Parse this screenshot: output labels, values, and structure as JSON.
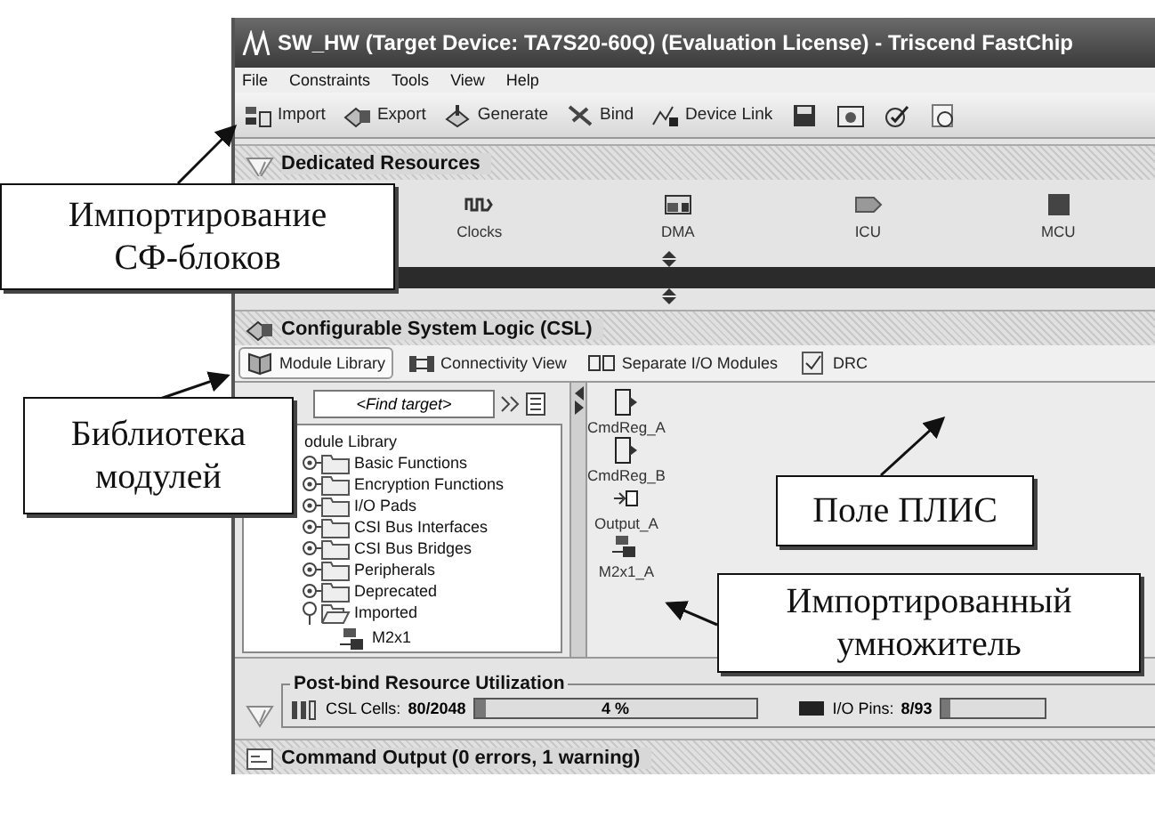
{
  "window": {
    "title": "SW_HW (Target Device: TA7S20-60Q) (Evaluation License) - Triscend FastChip"
  },
  "menu": [
    "File",
    "Constraints",
    "Tools",
    "View",
    "Help"
  ],
  "toolbar": [
    {
      "kind": "import",
      "label": "Import"
    },
    {
      "kind": "export",
      "label": "Export"
    },
    {
      "kind": "generate",
      "label": "Generate"
    },
    {
      "kind": "bind",
      "label": "Bind"
    },
    {
      "kind": "link",
      "label": "Device Link"
    },
    {
      "kind": "save"
    },
    {
      "kind": "window"
    },
    {
      "kind": "check"
    },
    {
      "kind": "timer"
    }
  ],
  "dedicated_resources": {
    "title": "Dedicated Resources",
    "items": [
      {
        "kind": "clock",
        "label": "Clocks"
      },
      {
        "kind": "dma",
        "label": "DMA"
      },
      {
        "kind": "intr",
        "label": "ICU"
      },
      {
        "kind": "mcu",
        "label": "MCU"
      }
    ]
  },
  "csl": {
    "title": "Configurable System Logic (CSL)",
    "tabs": [
      {
        "kind": "library",
        "label": "Module Library",
        "selected": true
      },
      {
        "kind": "connect",
        "label": "Connectivity View",
        "selected": false
      },
      {
        "kind": "separate",
        "label": "Separate I/O Modules",
        "selected": false
      },
      {
        "kind": "drc",
        "label": "DRC",
        "selected": false
      }
    ],
    "find": {
      "value": "<Find target>"
    },
    "tree": {
      "label": "odule Library",
      "children": [
        {
          "label": "Basic Functions",
          "expanded": false
        },
        {
          "label": "Encryption Functions",
          "expanded": false
        },
        {
          "label": "I/O Pads",
          "expanded": false
        },
        {
          "label": "CSI Bus Interfaces",
          "expanded": false
        },
        {
          "label": "CSI Bus Bridges",
          "expanded": false
        },
        {
          "label": "Peripherals",
          "expanded": false
        },
        {
          "label": "Deprecated",
          "expanded": false
        },
        {
          "label": "Imported",
          "expanded": true,
          "children": [
            {
              "label": "M2x1"
            }
          ]
        }
      ]
    },
    "modules": [
      {
        "kind": "register",
        "label": "CmdReg_A"
      },
      {
        "kind": "register",
        "label": "CmdReg_B"
      },
      {
        "kind": "output",
        "label": "Output_A"
      },
      {
        "kind": "multiplier",
        "label": "M2x1_A"
      }
    ]
  },
  "utilization": {
    "title": "Post-bind Resource Utilization",
    "csl": {
      "label": "CSL Cells:",
      "value": "80/2048",
      "level": 0.04,
      "percent": "4 %"
    },
    "io": {
      "label": "I/O Pins:",
      "value": "8/93",
      "level": 0.09
    }
  },
  "command_output": {
    "title": "Command Output (0 errors, 1 warning)"
  },
  "callouts": [
    {
      "text": "Импортирование\nСФ-блоков"
    },
    {
      "text": "Библиотека\nмодулей"
    },
    {
      "text": "Поле ПЛИС"
    },
    {
      "text": "Импортированный\nумножитель"
    }
  ]
}
